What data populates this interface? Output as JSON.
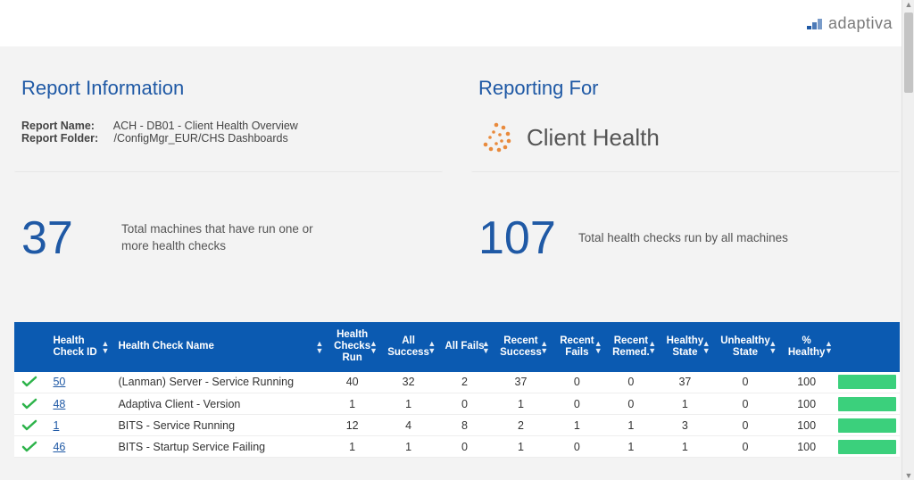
{
  "brand": {
    "name": "adaptiva"
  },
  "left": {
    "title": "Report Information",
    "name_label": "Report Name:",
    "name_value": "ACH - DB01 - Client Health Overview",
    "folder_label": "Report Folder:",
    "folder_value": "/ConfigMgr_EUR/CHS Dashboards"
  },
  "right": {
    "title": "Reporting For",
    "product_name": "Client Health"
  },
  "stats": {
    "machines": {
      "value": "37",
      "desc": "Total machines that have run one or more health checks"
    },
    "checks": {
      "value": "107",
      "desc": "Total health checks run by all machines"
    }
  },
  "table": {
    "headers": {
      "status": "",
      "id": "Health Check ID",
      "name": "Health Check Name",
      "run": "Health Checks Run",
      "success": "All Success",
      "fails": "All Fails",
      "rsuccess": "Recent Success",
      "rfails": "Recent Fails",
      "rremed": "Recent Remed.",
      "hstate": "Healthy State",
      "ustate": "Unhealthy State",
      "phealthy": "% Healthy"
    },
    "rows": [
      {
        "id": "50",
        "name": "(Lanman) Server - Service Running",
        "run": "40",
        "success": "32",
        "fails": "2",
        "rsuccess": "37",
        "rfails": "0",
        "rremed": "0",
        "hstate": "37",
        "ustate": "0",
        "phealthy": "100"
      },
      {
        "id": "48",
        "name": "Adaptiva Client - Version",
        "run": "1",
        "success": "1",
        "fails": "0",
        "rsuccess": "1",
        "rfails": "0",
        "rremed": "0",
        "hstate": "1",
        "ustate": "0",
        "phealthy": "100"
      },
      {
        "id": "1",
        "name": "BITS - Service Running",
        "run": "12",
        "success": "4",
        "fails": "8",
        "rsuccess": "2",
        "rfails": "1",
        "rremed": "1",
        "hstate": "3",
        "ustate": "0",
        "phealthy": "100"
      },
      {
        "id": "46",
        "name": "BITS - Startup Service Failing",
        "run": "1",
        "success": "1",
        "fails": "0",
        "rsuccess": "1",
        "rfails": "0",
        "rremed": "1",
        "hstate": "1",
        "ustate": "0",
        "phealthy": "100"
      }
    ]
  }
}
